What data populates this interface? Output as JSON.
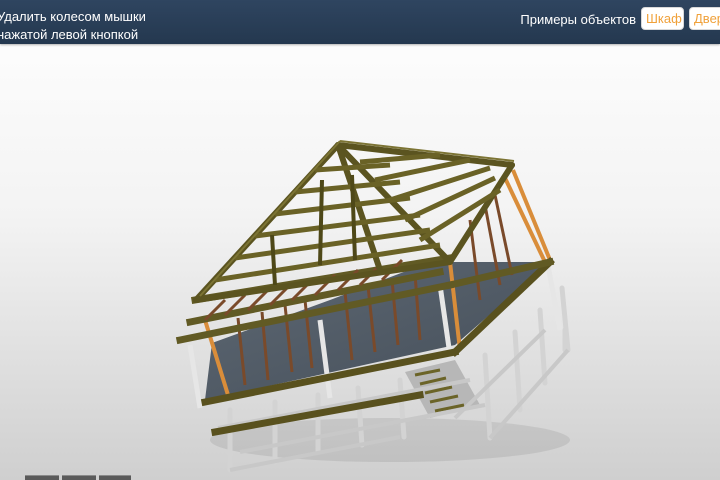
{
  "header": {
    "hint_line1": "Удалить колесом мышки",
    "hint_line2": "нажатой левой кнопкой",
    "examples_label": "Примеры объектов",
    "buttons": [
      {
        "label": "Шкаф"
      },
      {
        "label": "Двер"
      }
    ]
  },
  "colors": {
    "header_bg": "#2a3f57",
    "accent": "#f0a13a",
    "wood_dark": "#5d5520",
    "wood_orange": "#d98d3a",
    "metal": "#d0d0d0",
    "floor": "#4a5663"
  }
}
